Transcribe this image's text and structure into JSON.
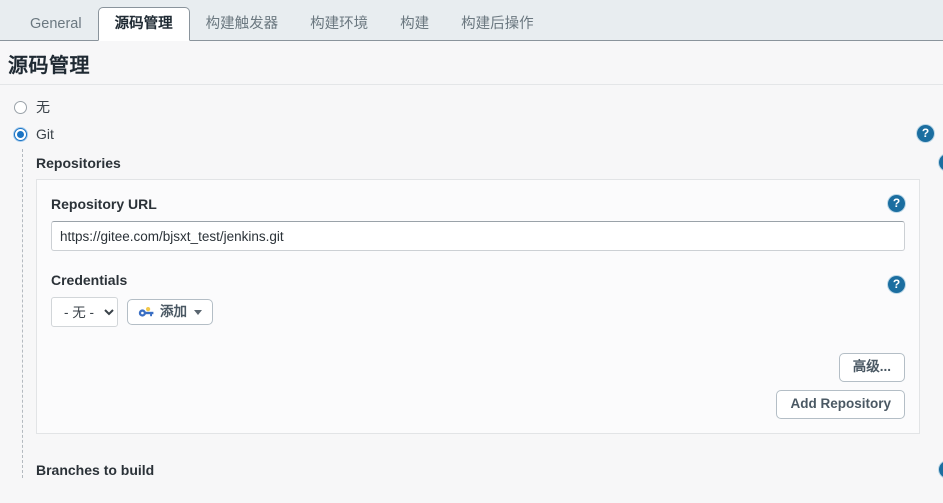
{
  "tabs": [
    {
      "label": "General",
      "active": false
    },
    {
      "label": "源码管理",
      "active": true
    },
    {
      "label": "构建触发器",
      "active": false
    },
    {
      "label": "构建环境",
      "active": false
    },
    {
      "label": "构建",
      "active": false
    },
    {
      "label": "构建后操作",
      "active": false
    }
  ],
  "page": {
    "title": "源码管理",
    "help_glyph": "?"
  },
  "scm": {
    "options": [
      {
        "label": "无",
        "selected": false
      },
      {
        "label": "Git",
        "selected": true
      }
    ]
  },
  "repositories": {
    "section_label": "Repositories",
    "url_label": "Repository URL",
    "url_value": "https://gitee.com/bjsxt_test/jenkins.git",
    "url_placeholder": "",
    "credentials_label": "Credentials",
    "credentials_selected": "- 无 -",
    "credentials_options": [
      "- 无 -"
    ],
    "add_credentials_label": "添加",
    "advanced_label": "高级...",
    "add_repository_label": "Add Repository"
  },
  "branches": {
    "label": "Branches to build"
  },
  "colors": {
    "accent": "#1b74c4",
    "help_blue": "#1b6ea0",
    "tabbar_bg": "#e8edf0",
    "page_bg": "#f7f7f8"
  }
}
